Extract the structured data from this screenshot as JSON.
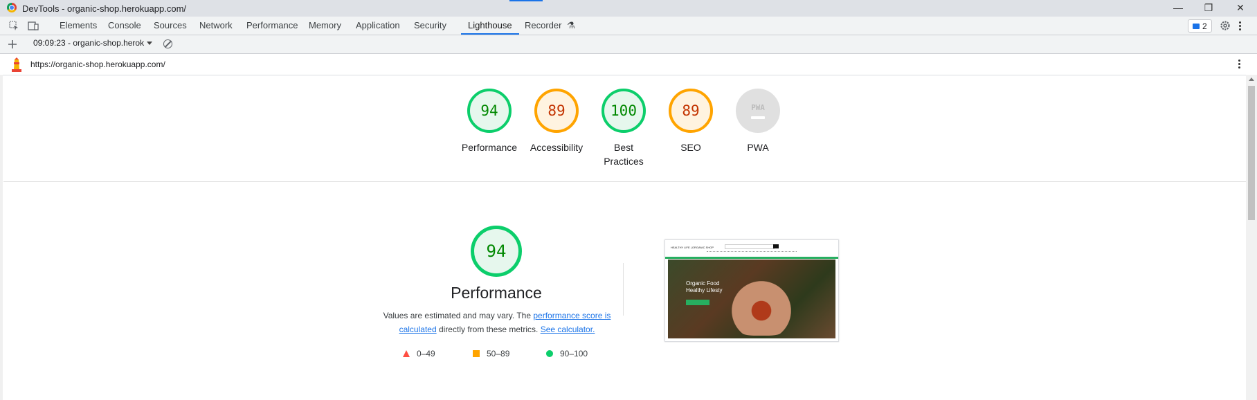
{
  "window": {
    "title": "DevTools - organic-shop.herokuapp.com/"
  },
  "tabs": [
    {
      "label": "Elements"
    },
    {
      "label": "Console"
    },
    {
      "label": "Sources"
    },
    {
      "label": "Network"
    },
    {
      "label": "Performance"
    },
    {
      "label": "Memory"
    },
    {
      "label": "Application"
    },
    {
      "label": "Security"
    },
    {
      "label": "Lighthouse",
      "active": true
    },
    {
      "label": "Recorder"
    }
  ],
  "issues_count": "2",
  "report": {
    "selected": "09:09:23 - organic-shop.herok"
  },
  "url": "https://organic-shop.herokuapp.com/",
  "scores": [
    {
      "value": "94",
      "label": "Performance",
      "status": "pass"
    },
    {
      "value": "89",
      "label": "Accessibility",
      "status": "average"
    },
    {
      "value": "100",
      "label": "Best Practices",
      "status": "pass"
    },
    {
      "value": "89",
      "label": "SEO",
      "status": "average"
    },
    {
      "value": "PWA",
      "label": "PWA",
      "status": "na"
    }
  ],
  "performance": {
    "score": "94",
    "title": "Performance",
    "desc_before": "Values are estimated and may vary. The ",
    "desc_link1": "performance score is calculated",
    "desc_middle": " directly from these metrics. ",
    "desc_link2": "See calculator."
  },
  "legend": {
    "fail": "0–49",
    "average": "50–89",
    "pass": "90–100"
  },
  "screenshot": {
    "hero_text": "Organic Food Healthy Lifesty",
    "logo_text": "HEALTHY LIFE | ORGANIC SHOP"
  },
  "colors": {
    "pass": "#0cce6b",
    "average": "#ffa400",
    "fail": "#ff4e42",
    "accent": "#1a73e8"
  }
}
